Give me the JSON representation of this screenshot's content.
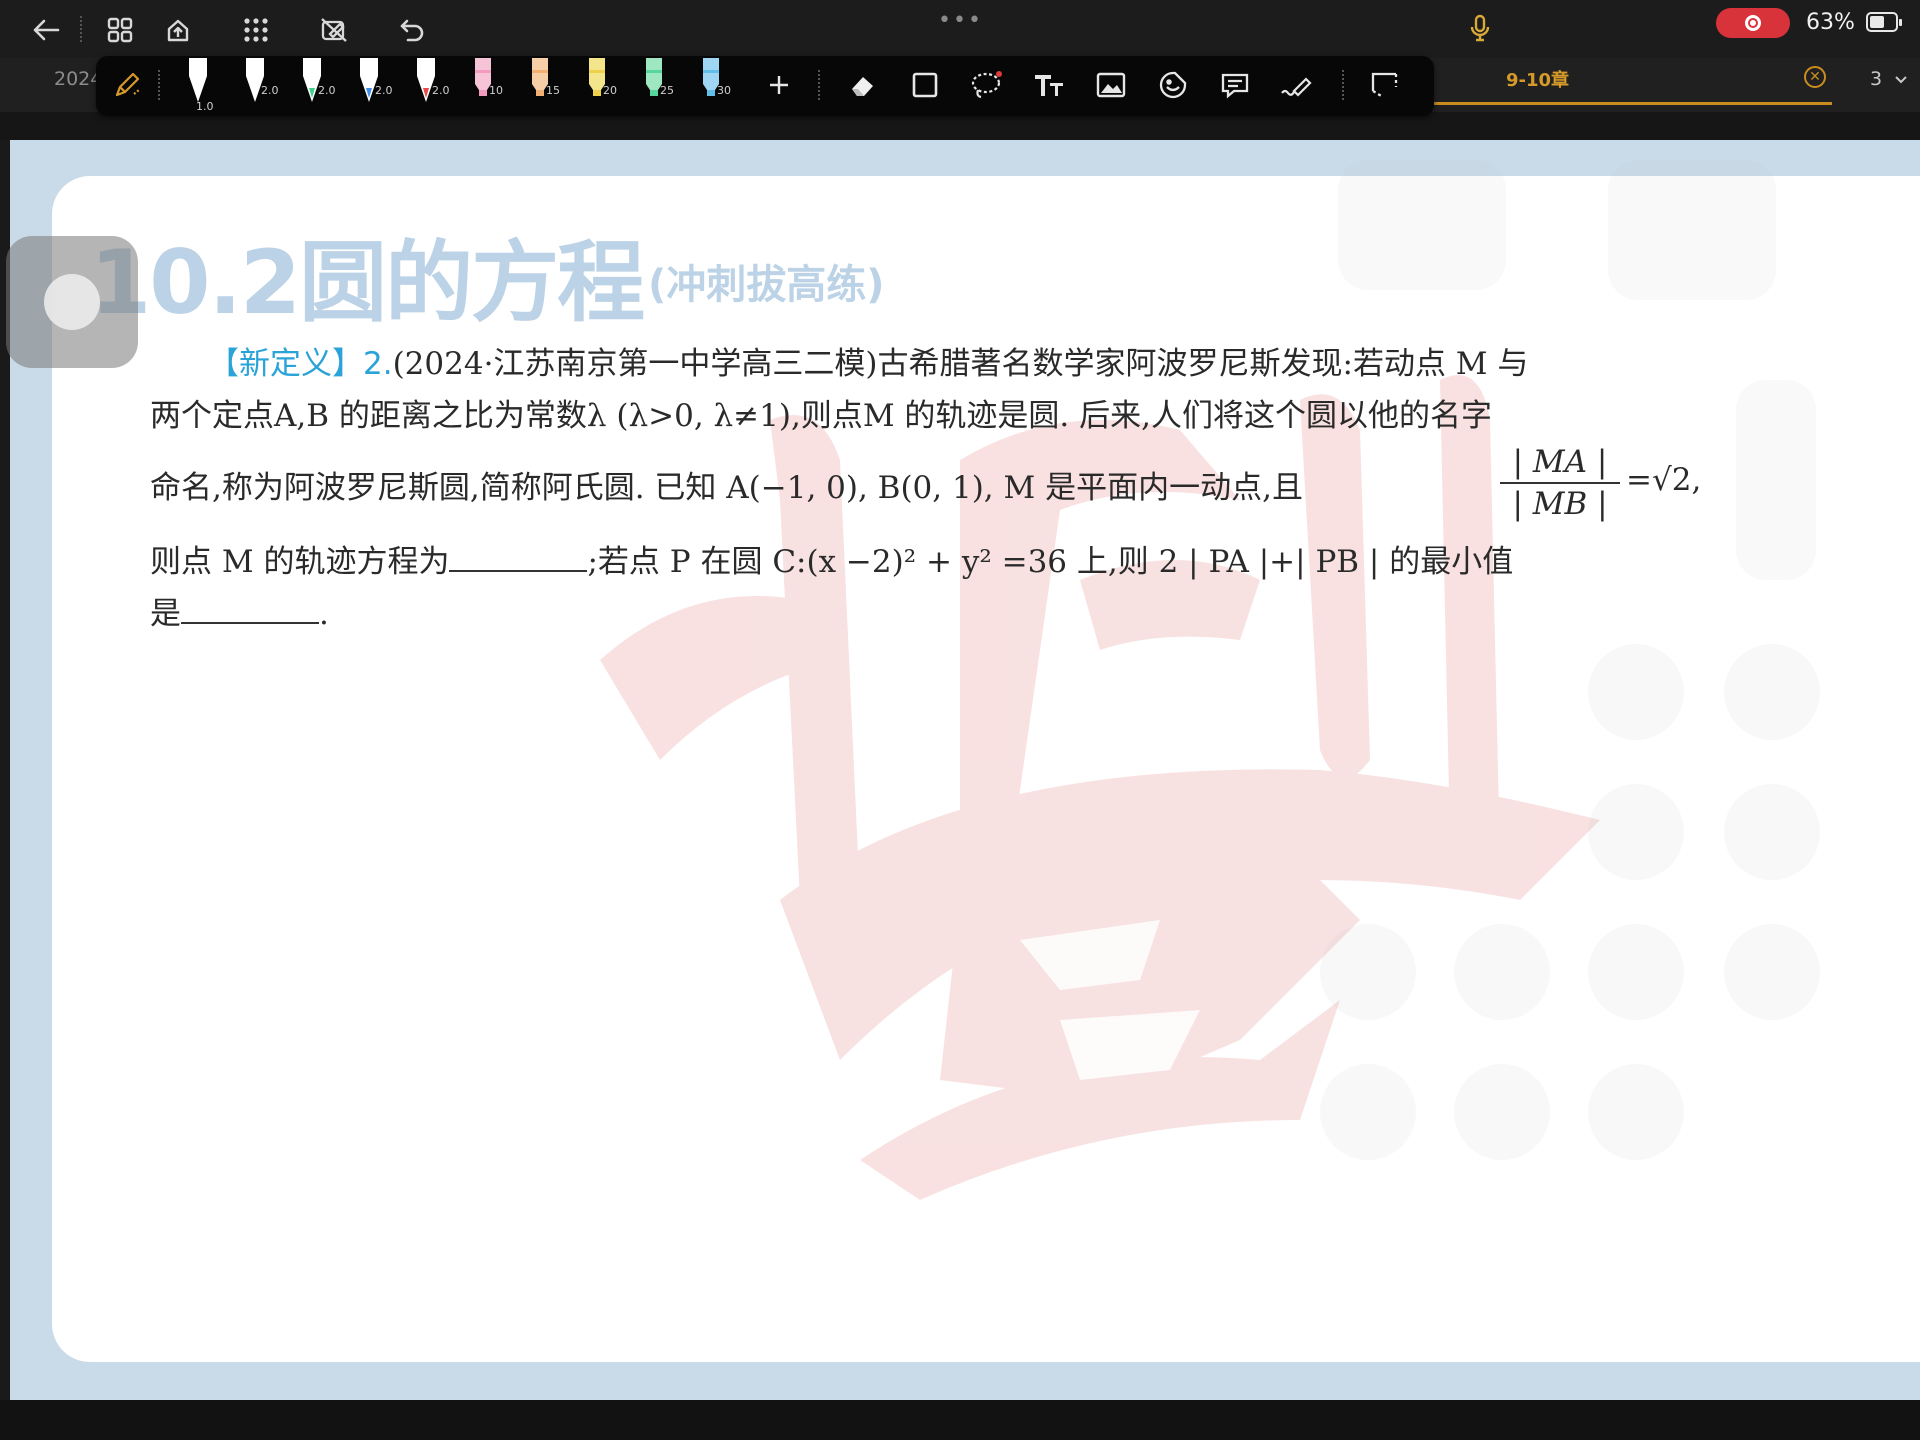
{
  "status_bar": {
    "battery_percent": "63%"
  },
  "tabs": {
    "left_partial": "2024",
    "active": "9-10章",
    "page_number": "3"
  },
  "pen_toolbar": {
    "pen_sizes": [
      "1.0",
      "2.0",
      "2.0",
      "2.0",
      "2.0",
      "10",
      "15",
      "20",
      "25",
      "30"
    ],
    "pen_colors": [
      "#ffffff",
      "#ffffff",
      "#ffffff",
      "#ffffff",
      "#ffffff",
      "#f7c4d7",
      "#f6cfa6",
      "#f3e58c",
      "#9ee7c0",
      "#9fd6f3"
    ],
    "pen_tip_colors": [
      "#ffffff",
      "#ffffff",
      "#3fd28a",
      "#3f8ee8",
      "#e74a4a",
      "#f29ac0",
      "#f2b072",
      "#eed04a",
      "#55d69a",
      "#5fbfe8"
    ],
    "accent": "#d59a2a"
  },
  "document": {
    "section_title": "10.2圆的方程",
    "section_subtitle": "(冲刺拔高练)",
    "problem": {
      "tag": "【新定义】2.",
      "line1": "(2024·江苏南京第一中学高三二模)古希腊著名数学家阿波罗尼斯发现:若动点 M 与",
      "line2": "两个定点A,B 的距离之比为常数λ (λ>0, λ≠1),则点M 的轨迹是圆. 后来,人们将这个圆以他的名字",
      "line3": "命名,称为阿波罗尼斯圆,简称阿氏圆. 已知 A(−1, 0), B(0, 1), M 是平面内一动点,且",
      "fraction_num": "| MA |",
      "fraction_den": "| MB |",
      "fraction_rhs": "=√2,",
      "line4_a": "则点 M 的轨迹方程为",
      "line4_b": ";若点 P 在圆 C:(x −2)² + y² =36 上,则 2 | PA |+| PB | 的最小值",
      "line5_a": "是",
      "line5_b": "."
    }
  }
}
